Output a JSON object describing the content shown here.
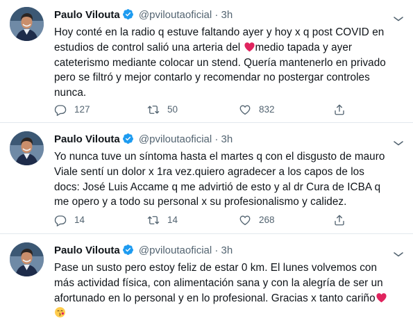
{
  "colors": {
    "verified": "#1d9bf0",
    "heart": "#e0245e",
    "text": "#0f1419",
    "muted": "#536471",
    "divider": "#e1e8ed"
  },
  "tweets": [
    {
      "author": {
        "name": "Paulo Vilouta",
        "handle": "@pviloutaoficial",
        "sep": "·",
        "time": "3h"
      },
      "text_before": "Hoy conté en la radio q estuve faltando ayer y hoy x q post COVID en estudios de control salió una arteria del ",
      "text_after": "medio tapada y ayer cateterismo mediante colocar un stend. Quería mantenerlo en privado pero se filtró y mejor contarlo y recomendar no postergar controles nunca.",
      "stats": {
        "replies": "127",
        "retweets": "50",
        "likes": "832"
      }
    },
    {
      "author": {
        "name": "Paulo Vilouta",
        "handle": "@pviloutaoficial",
        "sep": "·",
        "time": "3h"
      },
      "text": "Yo nunca tuve un síntoma hasta el martes q con el disgusto de mauro Viale sentí un dolor x 1ra vez.quiero agradecer a los capos de los docs: José Luis Accame q me advirtió de esto y al dr Cura de ICBA q me opero y a todo su personal x su profesionalismo y calidez.",
      "stats": {
        "replies": "14",
        "retweets": "14",
        "likes": "268"
      }
    },
    {
      "author": {
        "name": "Paulo Vilouta",
        "handle": "@pviloutaoficial",
        "sep": "·",
        "time": "3h"
      },
      "text": "Pase un susto pero estoy feliz de estar 0 km. El lunes volvemos con más actividad física, con alimentación sana y con la alegría de ser un afortunado en lo personal y en lo profesional. Gracias x tanto cariño"
    }
  ]
}
